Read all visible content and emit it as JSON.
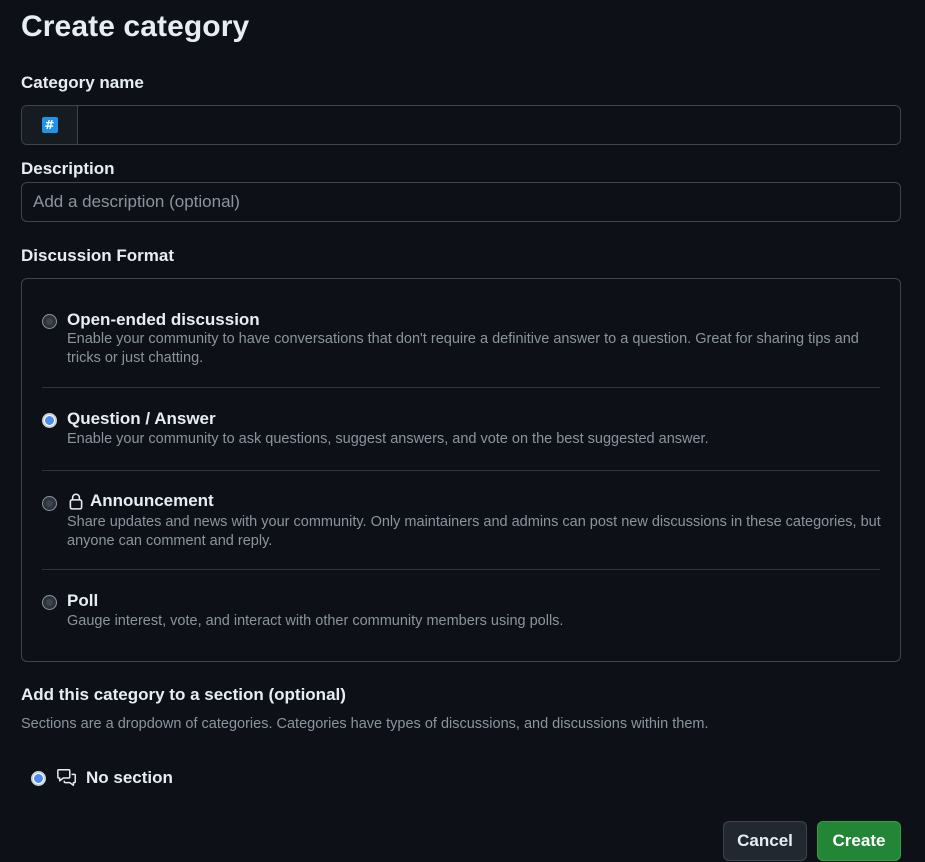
{
  "page": {
    "title": "Create category"
  },
  "category_name": {
    "label": "Category name",
    "emoji": "#",
    "value": ""
  },
  "description": {
    "label": "Description",
    "placeholder": "Add a description (optional)",
    "value": ""
  },
  "discussion_format": {
    "label": "Discussion Format",
    "selected": "Question / Answer",
    "options": [
      {
        "title": "Open-ended discussion",
        "description": "Enable your community to have conversations that don't require a definitive answer to a question. Great for sharing tips and tricks or just chatting.",
        "checked": false
      },
      {
        "title": "Question / Answer",
        "description": "Enable your community to ask questions, suggest answers, and vote on the best suggested answer.",
        "checked": true
      },
      {
        "title": "Announcement",
        "icon": "lock-icon",
        "description": "Share updates and news with your community. Only maintainers and admins can post new discussions in these categories, but anyone can comment and reply.",
        "checked": false
      },
      {
        "title": "Poll",
        "description": "Gauge interest, vote, and interact with other community members using polls.",
        "checked": false
      }
    ]
  },
  "section": {
    "label": "Add this category to a section (optional)",
    "description": "Sections are a dropdown of categories. Categories have types of discussions, and discussions within them.",
    "option": {
      "label": "No section",
      "icon": "discussion-icon",
      "checked": true
    }
  },
  "actions": {
    "cancel_label": "Cancel",
    "create_label": "Create"
  },
  "colors": {
    "background": "#0d1117",
    "border": "#3d444d",
    "primary_button": "#238636",
    "radio_checked": "#4c8ced",
    "emoji_badge": "#1f93ea"
  }
}
